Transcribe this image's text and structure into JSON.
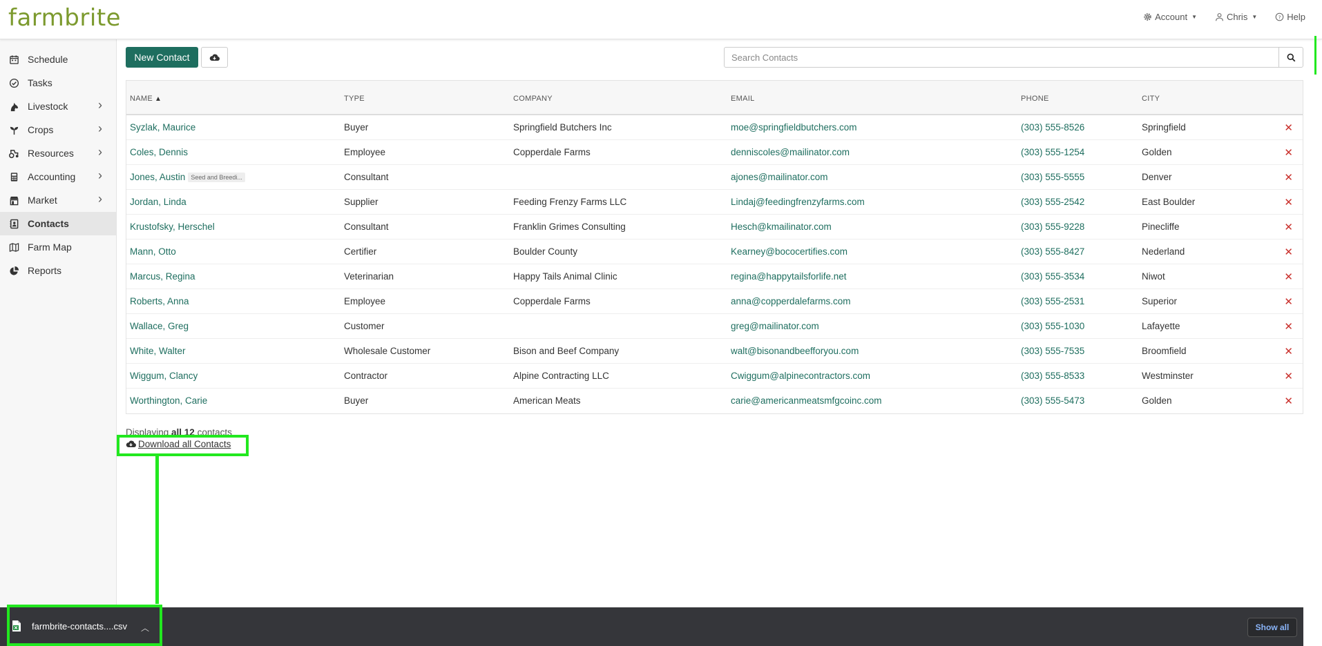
{
  "app": {
    "logo": "farmbrite"
  },
  "topnav": {
    "account": "Account",
    "user": "Chris",
    "help": "Help"
  },
  "sidebar": {
    "items": [
      {
        "label": "Schedule",
        "icon": "calendar-icon",
        "expandable": false,
        "active": false
      },
      {
        "label": "Tasks",
        "icon": "check-circle-icon",
        "expandable": false,
        "active": false
      },
      {
        "label": "Livestock",
        "icon": "horse-icon",
        "expandable": true,
        "active": false
      },
      {
        "label": "Crops",
        "icon": "seedling-icon",
        "expandable": true,
        "active": false
      },
      {
        "label": "Resources",
        "icon": "tractor-icon",
        "expandable": true,
        "active": false
      },
      {
        "label": "Accounting",
        "icon": "calculator-icon",
        "expandable": true,
        "active": false
      },
      {
        "label": "Market",
        "icon": "store-icon",
        "expandable": true,
        "active": false
      },
      {
        "label": "Contacts",
        "icon": "address-book-icon",
        "expandable": false,
        "active": true
      },
      {
        "label": "Farm Map",
        "icon": "map-icon",
        "expandable": false,
        "active": false
      },
      {
        "label": "Reports",
        "icon": "pie-chart-icon",
        "expandable": false,
        "active": false
      }
    ]
  },
  "toolbar": {
    "new_contact": "New Contact",
    "search_placeholder": "Search Contacts"
  },
  "table": {
    "headers": {
      "name": "NAME",
      "type": "TYPE",
      "company": "COMPANY",
      "email": "EMAIL",
      "phone": "PHONE",
      "city": "CITY"
    },
    "sorted_by": "name",
    "rows": [
      {
        "name": "Syzlak, Maurice",
        "tag": "",
        "type": "Buyer",
        "company": "Springfield Butchers Inc",
        "email": "moe@springfieldbutchers.com",
        "phone": "(303) 555-8526",
        "city": "Springfield"
      },
      {
        "name": "Coles, Dennis",
        "tag": "",
        "type": "Employee",
        "company": "Copperdale Farms",
        "email": "denniscoles@mailinator.com",
        "phone": "(303) 555-1254",
        "city": "Golden"
      },
      {
        "name": "Jones, Austin",
        "tag": "Seed and Breedi...",
        "type": "Consultant",
        "company": "",
        "email": "ajones@mailinator.com",
        "phone": "(303) 555-5555",
        "city": "Denver"
      },
      {
        "name": "Jordan, Linda",
        "tag": "",
        "type": "Supplier",
        "company": "Feeding Frenzy Farms LLC",
        "email": "Lindaj@feedingfrenzyfarms.com",
        "phone": "(303) 555-2542",
        "city": "East Boulder"
      },
      {
        "name": "Krustofsky, Herschel",
        "tag": "",
        "type": "Consultant",
        "company": "Franklin Grimes Consulting",
        "email": "Hesch@kmailinator.com",
        "phone": "(303) 555-9228",
        "city": "Pinecliffe"
      },
      {
        "name": "Mann, Otto",
        "tag": "",
        "type": "Certifier",
        "company": "Boulder County",
        "email": "Kearney@bococertifies.com",
        "phone": "(303) 555-8427",
        "city": "Nederland"
      },
      {
        "name": "Marcus, Regina",
        "tag": "",
        "type": "Veterinarian",
        "company": "Happy Tails Animal Clinic",
        "email": "regina@happytailsforlife.net",
        "phone": "(303) 555-3534",
        "city": "Niwot"
      },
      {
        "name": "Roberts, Anna",
        "tag": "",
        "type": "Employee",
        "company": "Copperdale Farms",
        "email": "anna@copperdalefarms.com",
        "phone": "(303) 555-2531",
        "city": "Superior"
      },
      {
        "name": "Wallace, Greg",
        "tag": "",
        "type": "Customer",
        "company": "",
        "email": "greg@mailinator.com",
        "phone": "(303) 555-1030",
        "city": "Lafayette"
      },
      {
        "name": "White, Walter",
        "tag": "",
        "type": "Wholesale Customer",
        "company": "Bison and Beef Company",
        "email": "walt@bisonandbeefforyou.com",
        "phone": "(303) 555-7535",
        "city": "Broomfield"
      },
      {
        "name": "Wiggum, Clancy",
        "tag": "",
        "type": "Contractor",
        "company": "Alpine Contracting LLC",
        "email": "Cwiggum@alpinecontractors.com",
        "phone": "(303) 555-8533",
        "city": "Westminster"
      },
      {
        "name": "Worthington, Carie",
        "tag": "",
        "type": "Buyer",
        "company": "American Meats",
        "email": "carie@americanmeatsmfgcoinc.com",
        "phone": "(303) 555-5473",
        "city": "Golden"
      }
    ]
  },
  "footer": {
    "displaying_prefix": "Displaying ",
    "displaying_bold": "all 12",
    "displaying_suffix": " contacts",
    "download_all": "Download all Contacts"
  },
  "download_bar": {
    "filename": "farmbrite-contacts....csv",
    "show_all": "Show all"
  },
  "colors": {
    "brand_green": "#1e6e5f",
    "logo_green": "#7c9a2e",
    "delete_red": "#c9302c",
    "highlight": "#22e81f"
  }
}
